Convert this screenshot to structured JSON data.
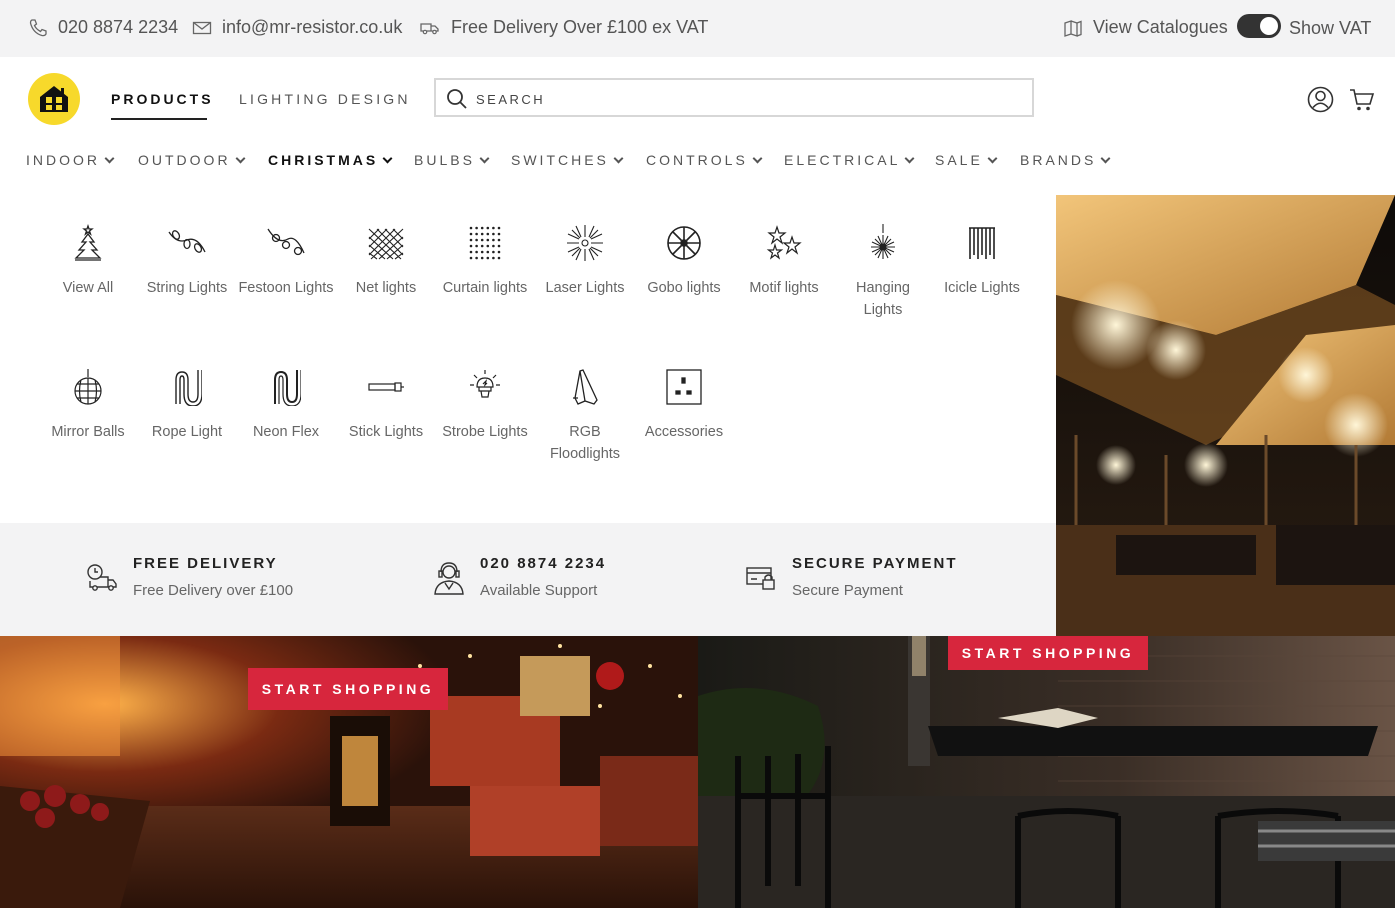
{
  "topbar": {
    "phone": "020 8874 2234",
    "email": "info@mr-resistor.co.uk",
    "delivery": "Free Delivery Over £100 ex VAT",
    "catalogues": "View Catalogues",
    "show_vat": "Show VAT",
    "show_vat_on": true
  },
  "header": {
    "nav": [
      "PRODUCTS",
      "LIGHTING DESIGN"
    ],
    "search_placeholder": "SEARCH"
  },
  "categories": [
    "INDOOR",
    "OUTDOOR",
    "CHRISTMAS",
    "BULBS",
    "SWITCHES",
    "CONTROLS",
    "ELECTRICAL",
    "SALE",
    "BRANDS"
  ],
  "dropdown": {
    "row1": [
      {
        "label": "View All",
        "icon": "tree-icon"
      },
      {
        "label": "String Lights",
        "icon": "string-lights-icon"
      },
      {
        "label": "Festoon Lights",
        "icon": "festoon-icon"
      },
      {
        "label": "Net lights",
        "icon": "net-lights-icon"
      },
      {
        "label": "Curtain lights",
        "icon": "curtain-lights-icon"
      },
      {
        "label": "Laser Lights",
        "icon": "laser-icon"
      },
      {
        "label": "Gobo lights",
        "icon": "gobo-icon"
      },
      {
        "label": "Motif lights",
        "icon": "motif-stars-icon"
      },
      {
        "label": "Hanging Lights",
        "icon": "hanging-burst-icon"
      },
      {
        "label": "Icicle Lights",
        "icon": "icicle-icon"
      }
    ],
    "row2": [
      {
        "label": "Mirror Balls",
        "icon": "mirror-ball-icon"
      },
      {
        "label": "Rope Light",
        "icon": "rope-light-icon"
      },
      {
        "label": "Neon Flex",
        "icon": "neon-flex-icon"
      },
      {
        "label": "Stick Lights",
        "icon": "stick-light-icon"
      },
      {
        "label": "Strobe Lights",
        "icon": "strobe-icon"
      },
      {
        "label": "RGB Floodlights",
        "icon": "floodlight-icon"
      },
      {
        "label": "Accessories",
        "icon": "socket-icon"
      }
    ]
  },
  "info_strip": [
    {
      "title": "FREE DELIVERY",
      "sub": "Free Delivery over £100",
      "icon": "delivery-truck-icon"
    },
    {
      "title": "020 8874 2234",
      "sub": "Available Support",
      "icon": "support-agent-icon"
    },
    {
      "title": "SECURE PAYMENT",
      "sub": "Secure Payment",
      "icon": "secure-card-icon"
    }
  ],
  "banners": {
    "left_button": "START SHOPPING",
    "right_button": "START SHOPPING"
  },
  "colors": {
    "accent": "#d7263d",
    "logo_yellow": "#f7d92b",
    "topbar_bg": "#f3f3f4"
  }
}
